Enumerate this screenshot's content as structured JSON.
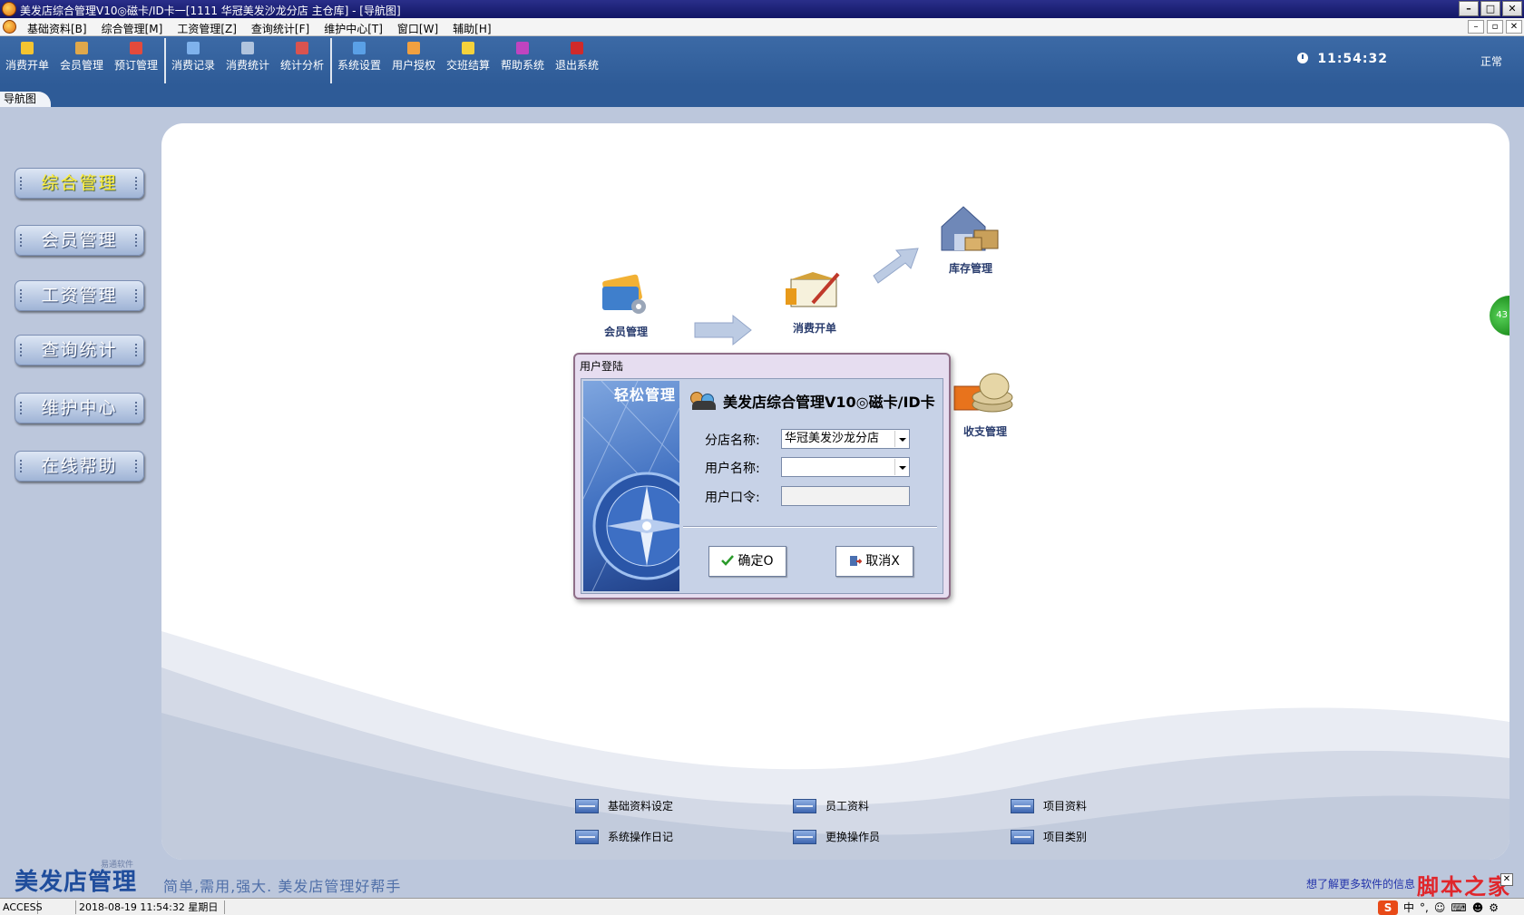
{
  "window": {
    "title": "美发店综合管理V10◎磁卡/ID卡一[1111 华冠美发沙龙分店 主仓库] - [导航图]",
    "buttons": [
      "–",
      "□",
      "✕"
    ]
  },
  "menubar": {
    "items": [
      "基础资料[B]",
      "综合管理[M]",
      "工资管理[Z]",
      "查询统计[F]",
      "维护中心[T]",
      "窗口[W]",
      "辅助[H]"
    ],
    "mdi_buttons": [
      "–",
      "▫",
      "✕"
    ]
  },
  "toolbar": {
    "group1": [
      "消费开单",
      "会员管理",
      "预订管理"
    ],
    "group2": [
      "消费记录",
      "消费统计",
      "统计分析"
    ],
    "group3": [
      "系统设置",
      "用户授权",
      "交班结算",
      "帮助系统",
      "退出系统"
    ],
    "clock": "11:54:32",
    "status": "正常"
  },
  "tabs": {
    "active": "导航图"
  },
  "leftnav": {
    "items": [
      "综合管理",
      "会员管理",
      "工资管理",
      "查询统计",
      "维护中心",
      "在线帮助"
    ]
  },
  "flow": {
    "member": "会员管理",
    "consume": "消费开单",
    "stock": "库存管理",
    "finance": "收支管理"
  },
  "quick_links": {
    "col1": [
      "基础资料设定",
      "系统操作日记"
    ],
    "col2": [
      "员工资料",
      "更换操作员"
    ],
    "col3": [
      "项目资料",
      "项目类别"
    ]
  },
  "side_bubble": "43",
  "brand": {
    "title": "美发店管理",
    "subtitle": "易通软件",
    "slogan": "简单,需用,强大. 美发店管理好帮手"
  },
  "promo": "想了解更多软件的信息",
  "watermark": "脚本之家",
  "statusbar": {
    "db": "ACCESS",
    "blank": "",
    "datetime": "2018-08-19 11:54:32 星期日"
  },
  "ime": [
    "S",
    "中",
    "°,",
    "☺",
    "⌨",
    "☻",
    "⚙"
  ],
  "login_dialog": {
    "title": "用户登陆",
    "image_caption": "轻松管理",
    "heading": "美发店综合管理V10◎磁卡/ID卡",
    "branch_label": "分店名称:",
    "branch_value": "华冠美发沙龙分店",
    "user_label": "用户名称:",
    "user_value": "",
    "password_label": "用户口令:",
    "password_value": "",
    "ok_label": "确定O",
    "cancel_label": "取消X"
  },
  "colors": {
    "toolbar_bg": "#2e5b97",
    "titlebar_bg": "#121665",
    "active_nav_text": "#ffef3a",
    "dialog_border": "#8f6e88"
  }
}
